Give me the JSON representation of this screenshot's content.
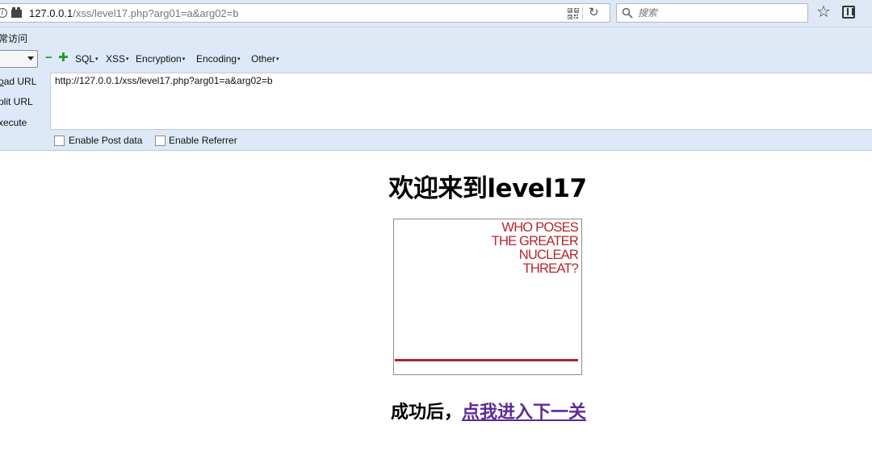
{
  "browser": {
    "url_host": "127.0.0.1",
    "url_path": "/xss/level17.php?arg01=a&arg02=b",
    "search_placeholder": "搜索"
  },
  "bookmarks": {
    "items": [
      {
        "label": "常访问"
      }
    ]
  },
  "hackbar": {
    "menus": [
      {
        "label": "SQL"
      },
      {
        "label": "XSS"
      },
      {
        "label": "Encryption"
      },
      {
        "label": "Encoding"
      },
      {
        "label": "Other"
      }
    ],
    "actions": [
      {
        "prefix": "",
        "underlined": "o",
        "suffix": "ad URL"
      },
      {
        "prefix": "",
        "underlined": "",
        "suffix": "plit URL"
      },
      {
        "prefix": "",
        "underlined": "",
        "suffix": "xecute"
      }
    ],
    "url_value": "http://127.0.0.1/xss/level17.php?arg01=a&arg02=b",
    "post_label": "Enable Post data",
    "referrer_label": "Enable Referrer"
  },
  "page": {
    "title": "欢迎来到level17",
    "poster_lines": [
      "WHO POSES",
      "THE GREATER",
      "NUCLEAR",
      "THREAT?"
    ],
    "success_text": "成功后，",
    "next_link": "点我进入下一关"
  },
  "colors": {
    "poster_red": "#b5262b",
    "link_purple": "#5d2a94",
    "toolbar_bg": "#dde9f8"
  }
}
